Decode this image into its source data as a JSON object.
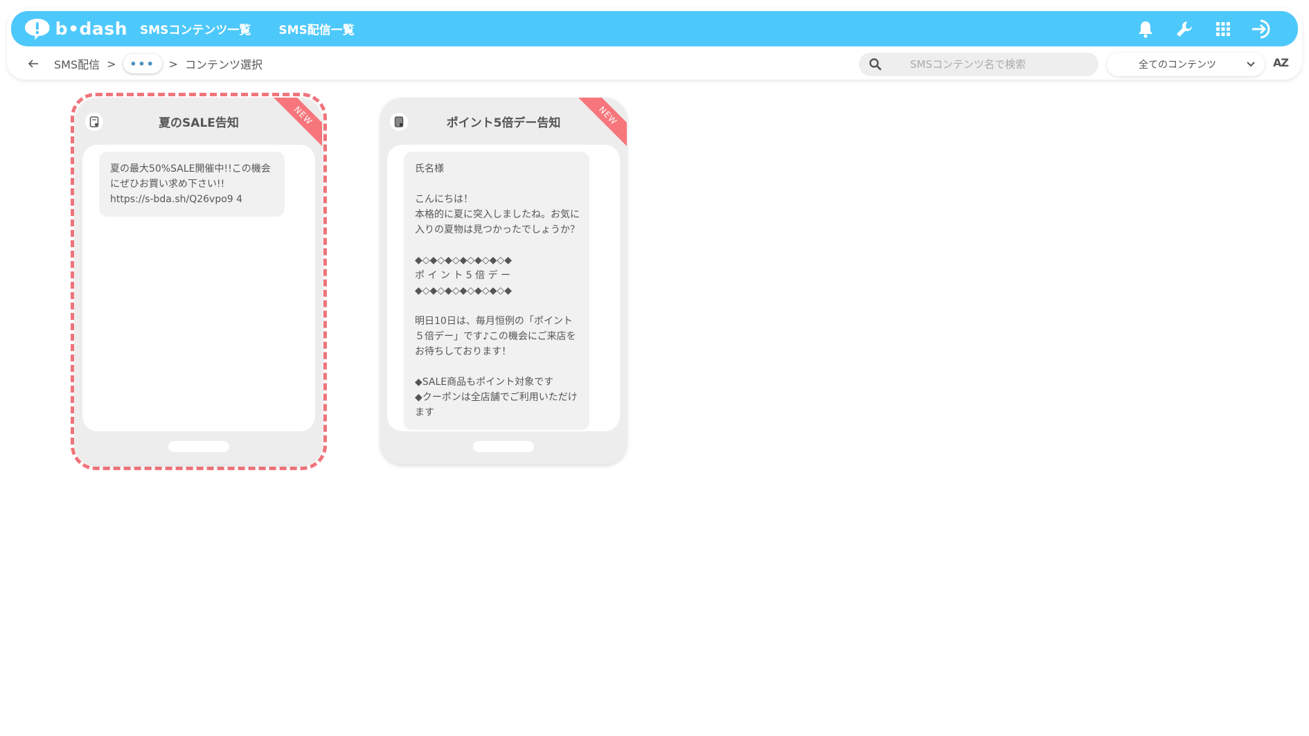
{
  "header": {
    "logo_text": "b•dash",
    "nav": [
      "SMSコンテンツ一覧",
      "SMS配信一覧"
    ],
    "icons": [
      "bell-icon",
      "wrench-icon",
      "grid-icon",
      "logout-icon"
    ],
    "accent_color": "#4dc8fb"
  },
  "subnav": {
    "breadcrumb": {
      "root": "SMS配信",
      "sep": ">",
      "more": "•••",
      "current": "コンテンツ選択"
    },
    "search": {
      "placeholder": "SMSコンテンツ名で検索"
    },
    "filter": {
      "selected": "全てのコンテンツ"
    },
    "sort_label": "AZ"
  },
  "cards": [
    {
      "title": "夏のSALE告知",
      "badge": "NEW",
      "selected": true,
      "message": "夏の最大50%SALE開催中!!この機会にぜひお買い求め下さい!!\nhttps://s-bda.sh/Q26vpo9 4"
    },
    {
      "title": "ポイント5倍デー告知",
      "badge": "NEW",
      "selected": false,
      "message": "氏名様\n\nこんにちは！\n本格的に夏に突入しましたね。お気に入りの夏物は見つかったでしょうか？\n\n◆◇◆◇◆◇◆◇◆◇◆◇◆\nポ イ ン ト 5 倍 デ ー\n◆◇◆◇◆◇◆◇◆◇◆◇◆\n\n明日10日は、毎月恒例の「ポイント５倍デー」です♪この機会にご来店をお待ちしております！\n\n◆SALE商品もポイント対象です\n◆クーポンは全店舗でご利用いただけます"
    }
  ],
  "colors": {
    "selection": "#f0757c",
    "badge": "#f7767b",
    "card_bg": "#ededed"
  }
}
